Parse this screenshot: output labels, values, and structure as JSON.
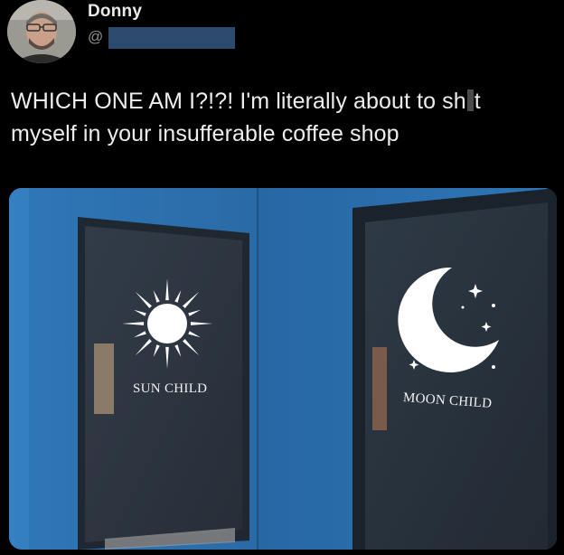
{
  "author": {
    "display_name": "Donny",
    "handle_prefix": "@",
    "avatar_icon": "profile-photo-icon"
  },
  "tweet": {
    "text_part1": "WHICH ONE AM I?!?! I'm literally about to sh",
    "text_part2": "t",
    "text_part3": "myself in your insufferable coffee shop"
  },
  "media": {
    "left_door_sign": "SUN CHILD",
    "right_door_sign": "MOON CHILD",
    "left_door_icon": "sun-icon",
    "right_door_icon": "crescent-moon-icon"
  },
  "colors": {
    "background": "#000000",
    "wall_blue": "#2a6fae",
    "door_dark": "#2c3540",
    "redaction": "#2c4a6e"
  }
}
